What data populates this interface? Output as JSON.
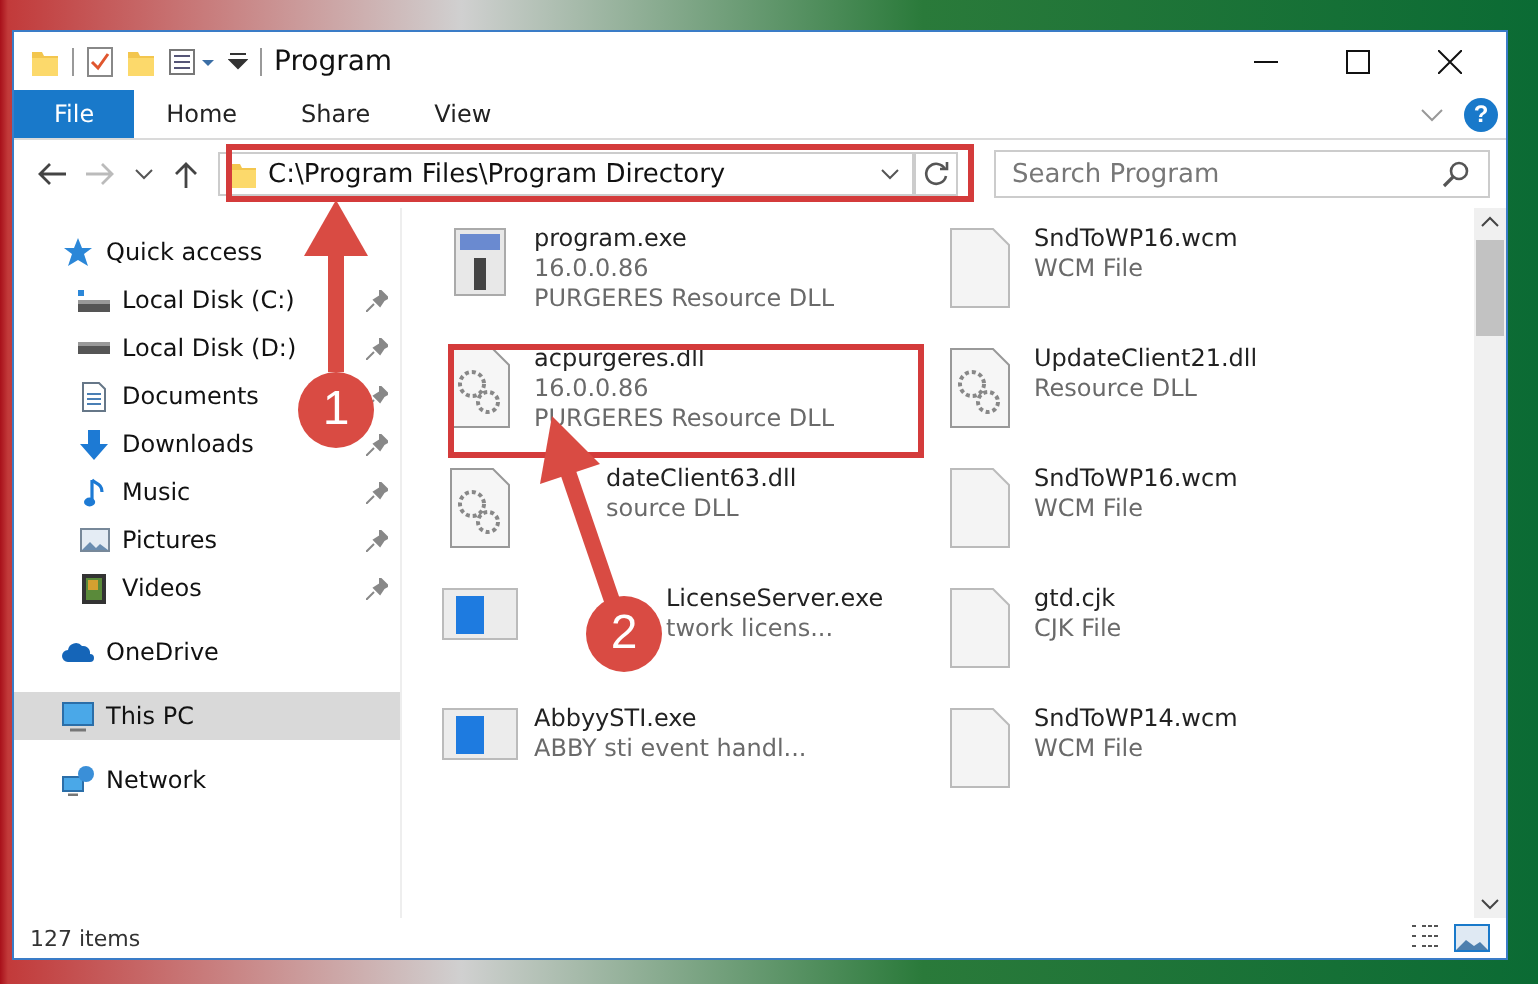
{
  "window": {
    "title": "Program"
  },
  "ribbon_tabs": [
    {
      "label": "File",
      "selected": true
    },
    {
      "label": "Home",
      "selected": false
    },
    {
      "label": "Share",
      "selected": false
    },
    {
      "label": "View",
      "selected": false
    }
  ],
  "help": "?",
  "address": {
    "path": "C:\\Program Files\\Program Directory"
  },
  "search": {
    "placeholder": "Search Program"
  },
  "sidebar": {
    "items": [
      {
        "label": "Quick access",
        "selected": false,
        "children": [
          {
            "label": "Local Disk (C:)",
            "pinned": true,
            "selected": false
          },
          {
            "label": "Local Disk (D:)",
            "pinned": true,
            "selected": false
          },
          {
            "label": "Documents",
            "pinned": true,
            "selected": false
          },
          {
            "label": "Downloads",
            "pinned": true,
            "selected": false
          },
          {
            "label": "Music",
            "pinned": true,
            "selected": false
          },
          {
            "label": "Pictures",
            "pinned": true,
            "selected": false
          },
          {
            "label": "Videos",
            "pinned": true,
            "selected": false
          }
        ]
      },
      {
        "label": "OneDrive",
        "selected": false
      },
      {
        "label": "This PC",
        "selected": true
      },
      {
        "label": "Network",
        "selected": false
      }
    ]
  },
  "files": [
    {
      "name": "program.exe",
      "lines": [
        "16.0.0.86",
        "PURGERES Resource DLL"
      ],
      "kind": "program"
    },
    {
      "name": "SndToWP16.wcm",
      "lines": [
        "WCM File"
      ],
      "kind": "file"
    },
    {
      "name": "acpurgeres.dll",
      "lines": [
        "16.0.0.86",
        "PURGERES Resource DLL"
      ],
      "kind": "library"
    },
    {
      "name": "UpdateClient21.dll",
      "lines": [
        "Resource DLL"
      ],
      "kind": "library"
    },
    {
      "name": "dateClient63.dll",
      "lines": [
        "source DLL"
      ],
      "kind": "library"
    },
    {
      "name": "SndToWP16.wcm",
      "lines": [
        "WCM File"
      ],
      "kind": "file"
    },
    {
      "name": "LicenseServer.exe",
      "lines": [
        "twork licens..."
      ],
      "kind": "app"
    },
    {
      "name": "gtd.cjk",
      "lines": [
        "CJK File"
      ],
      "kind": "file"
    },
    {
      "name": "AbbyySTI.exe",
      "lines": [
        "ABBY sti event handl..."
      ],
      "kind": "app"
    },
    {
      "name": "SndToWP14.wcm",
      "lines": [
        "WCM File"
      ],
      "kind": "file"
    }
  ],
  "status_bar": {
    "count": "127 items"
  },
  "annotations": [
    {
      "number": "1"
    },
    {
      "number": "2"
    }
  ]
}
